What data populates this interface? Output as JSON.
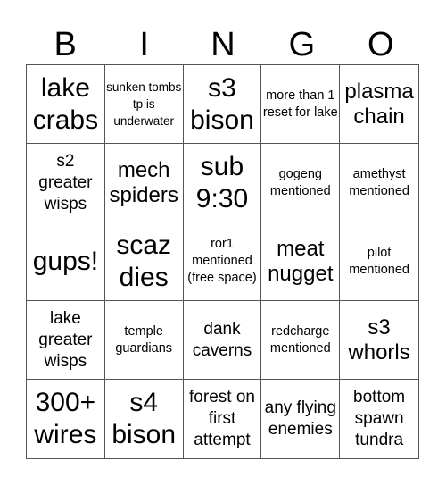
{
  "header": [
    "B",
    "I",
    "N",
    "G",
    "O"
  ],
  "cells": [
    {
      "text": "lake crabs",
      "size": "xl"
    },
    {
      "text": "sunken tombs tp is underwater",
      "size": "xs"
    },
    {
      "text": "s3 bison",
      "size": "xl"
    },
    {
      "text": "more than 1 reset for lake",
      "size": "sm"
    },
    {
      "text": "plasma chain",
      "size": "lg"
    },
    {
      "text": "s2 greater wisps",
      "size": "md"
    },
    {
      "text": "mech spiders",
      "size": "lg"
    },
    {
      "text": "sub 9:30",
      "size": "xl"
    },
    {
      "text": "gogeng mentioned",
      "size": "sm"
    },
    {
      "text": "amethyst mentioned",
      "size": "sm"
    },
    {
      "text": "gups!",
      "size": "xl"
    },
    {
      "text": "scaz dies",
      "size": "xl"
    },
    {
      "text": "ror1 mentioned (free space)",
      "size": "sm"
    },
    {
      "text": "meat nugget",
      "size": "lg"
    },
    {
      "text": "pilot mentioned",
      "size": "sm"
    },
    {
      "text": "lake greater wisps",
      "size": "md"
    },
    {
      "text": "temple guardians",
      "size": "sm"
    },
    {
      "text": "dank caverns",
      "size": "md"
    },
    {
      "text": "redcharge mentioned",
      "size": "sm"
    },
    {
      "text": "s3 whorls",
      "size": "lg"
    },
    {
      "text": "300+ wires",
      "size": "xl"
    },
    {
      "text": "s4 bison",
      "size": "xl"
    },
    {
      "text": "forest on first attempt",
      "size": "md"
    },
    {
      "text": "any flying enemies",
      "size": "md"
    },
    {
      "text": "bottom spawn tundra",
      "size": "md"
    }
  ]
}
